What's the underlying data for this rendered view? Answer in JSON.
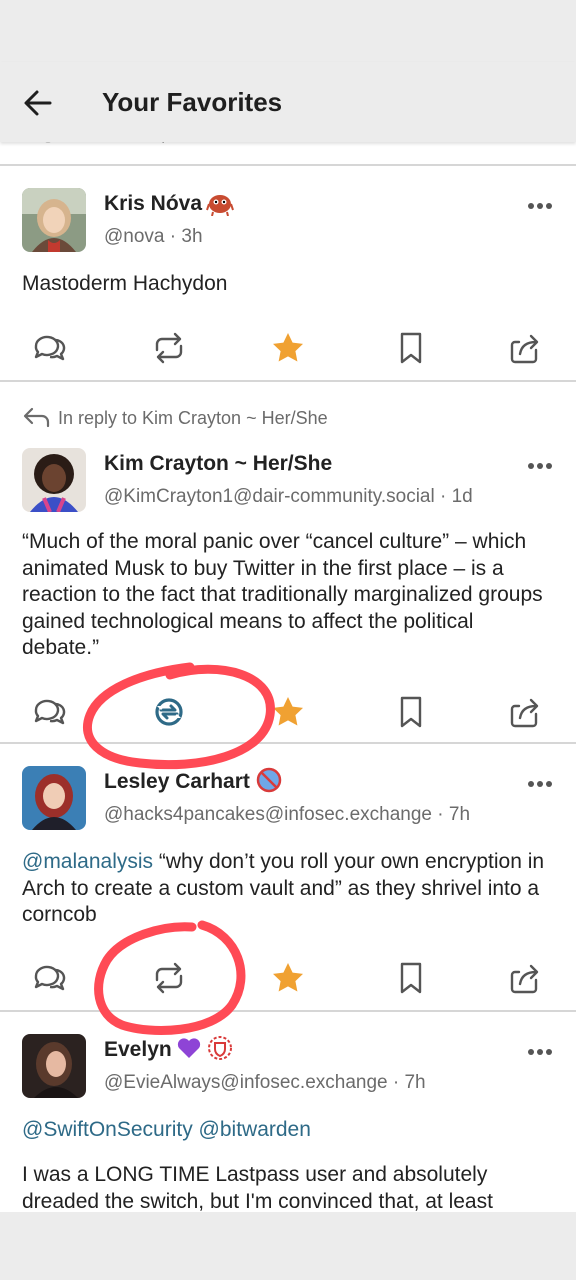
{
  "header": {
    "title": "Your Favorites",
    "back_icon": "arrow-left-icon"
  },
  "colors": {
    "star": "#f0a132",
    "boost_active": "#2e6a87",
    "mention": "#2e6a87",
    "annotation": "#ff4a55"
  },
  "posts": [
    {
      "name": "Kris Nóva",
      "handle": "@nova · 3h",
      "content": "Mastoderm Hachydon",
      "favourited": true
    },
    {
      "reply_context": "In reply to Kim Crayton ~ Her/She",
      "name": "Kim Crayton ~ Her/She",
      "handle": "@KimCrayton1@dair-community.social · 1d",
      "content": "“Much of the moral panic over “cancel culture” – which animated Musk to buy Twitter in the first place – is a reaction to the fact that traditionally marginalized groups gained technological means to affect the political debate.”",
      "favourited": true,
      "boosted": true
    },
    {
      "name": "Lesley Carhart",
      "handle": "@hacks4pancakes@infosec.exchange · 7h",
      "mention": "@malanalysis",
      "content": " “why don’t you roll your own encryption in Arch to create a custom vault and” as they shrivel into a corncob",
      "favourited": true
    },
    {
      "name": "Evelyn",
      "handle": "@EvieAlways@infosec.exchange · 7h",
      "mention_line": "@SwiftOnSecurity @bitwarden",
      "content": "I was a LONG TIME Lastpass user and absolutely dreaded the switch, but I'm convinced that, at least"
    }
  ]
}
